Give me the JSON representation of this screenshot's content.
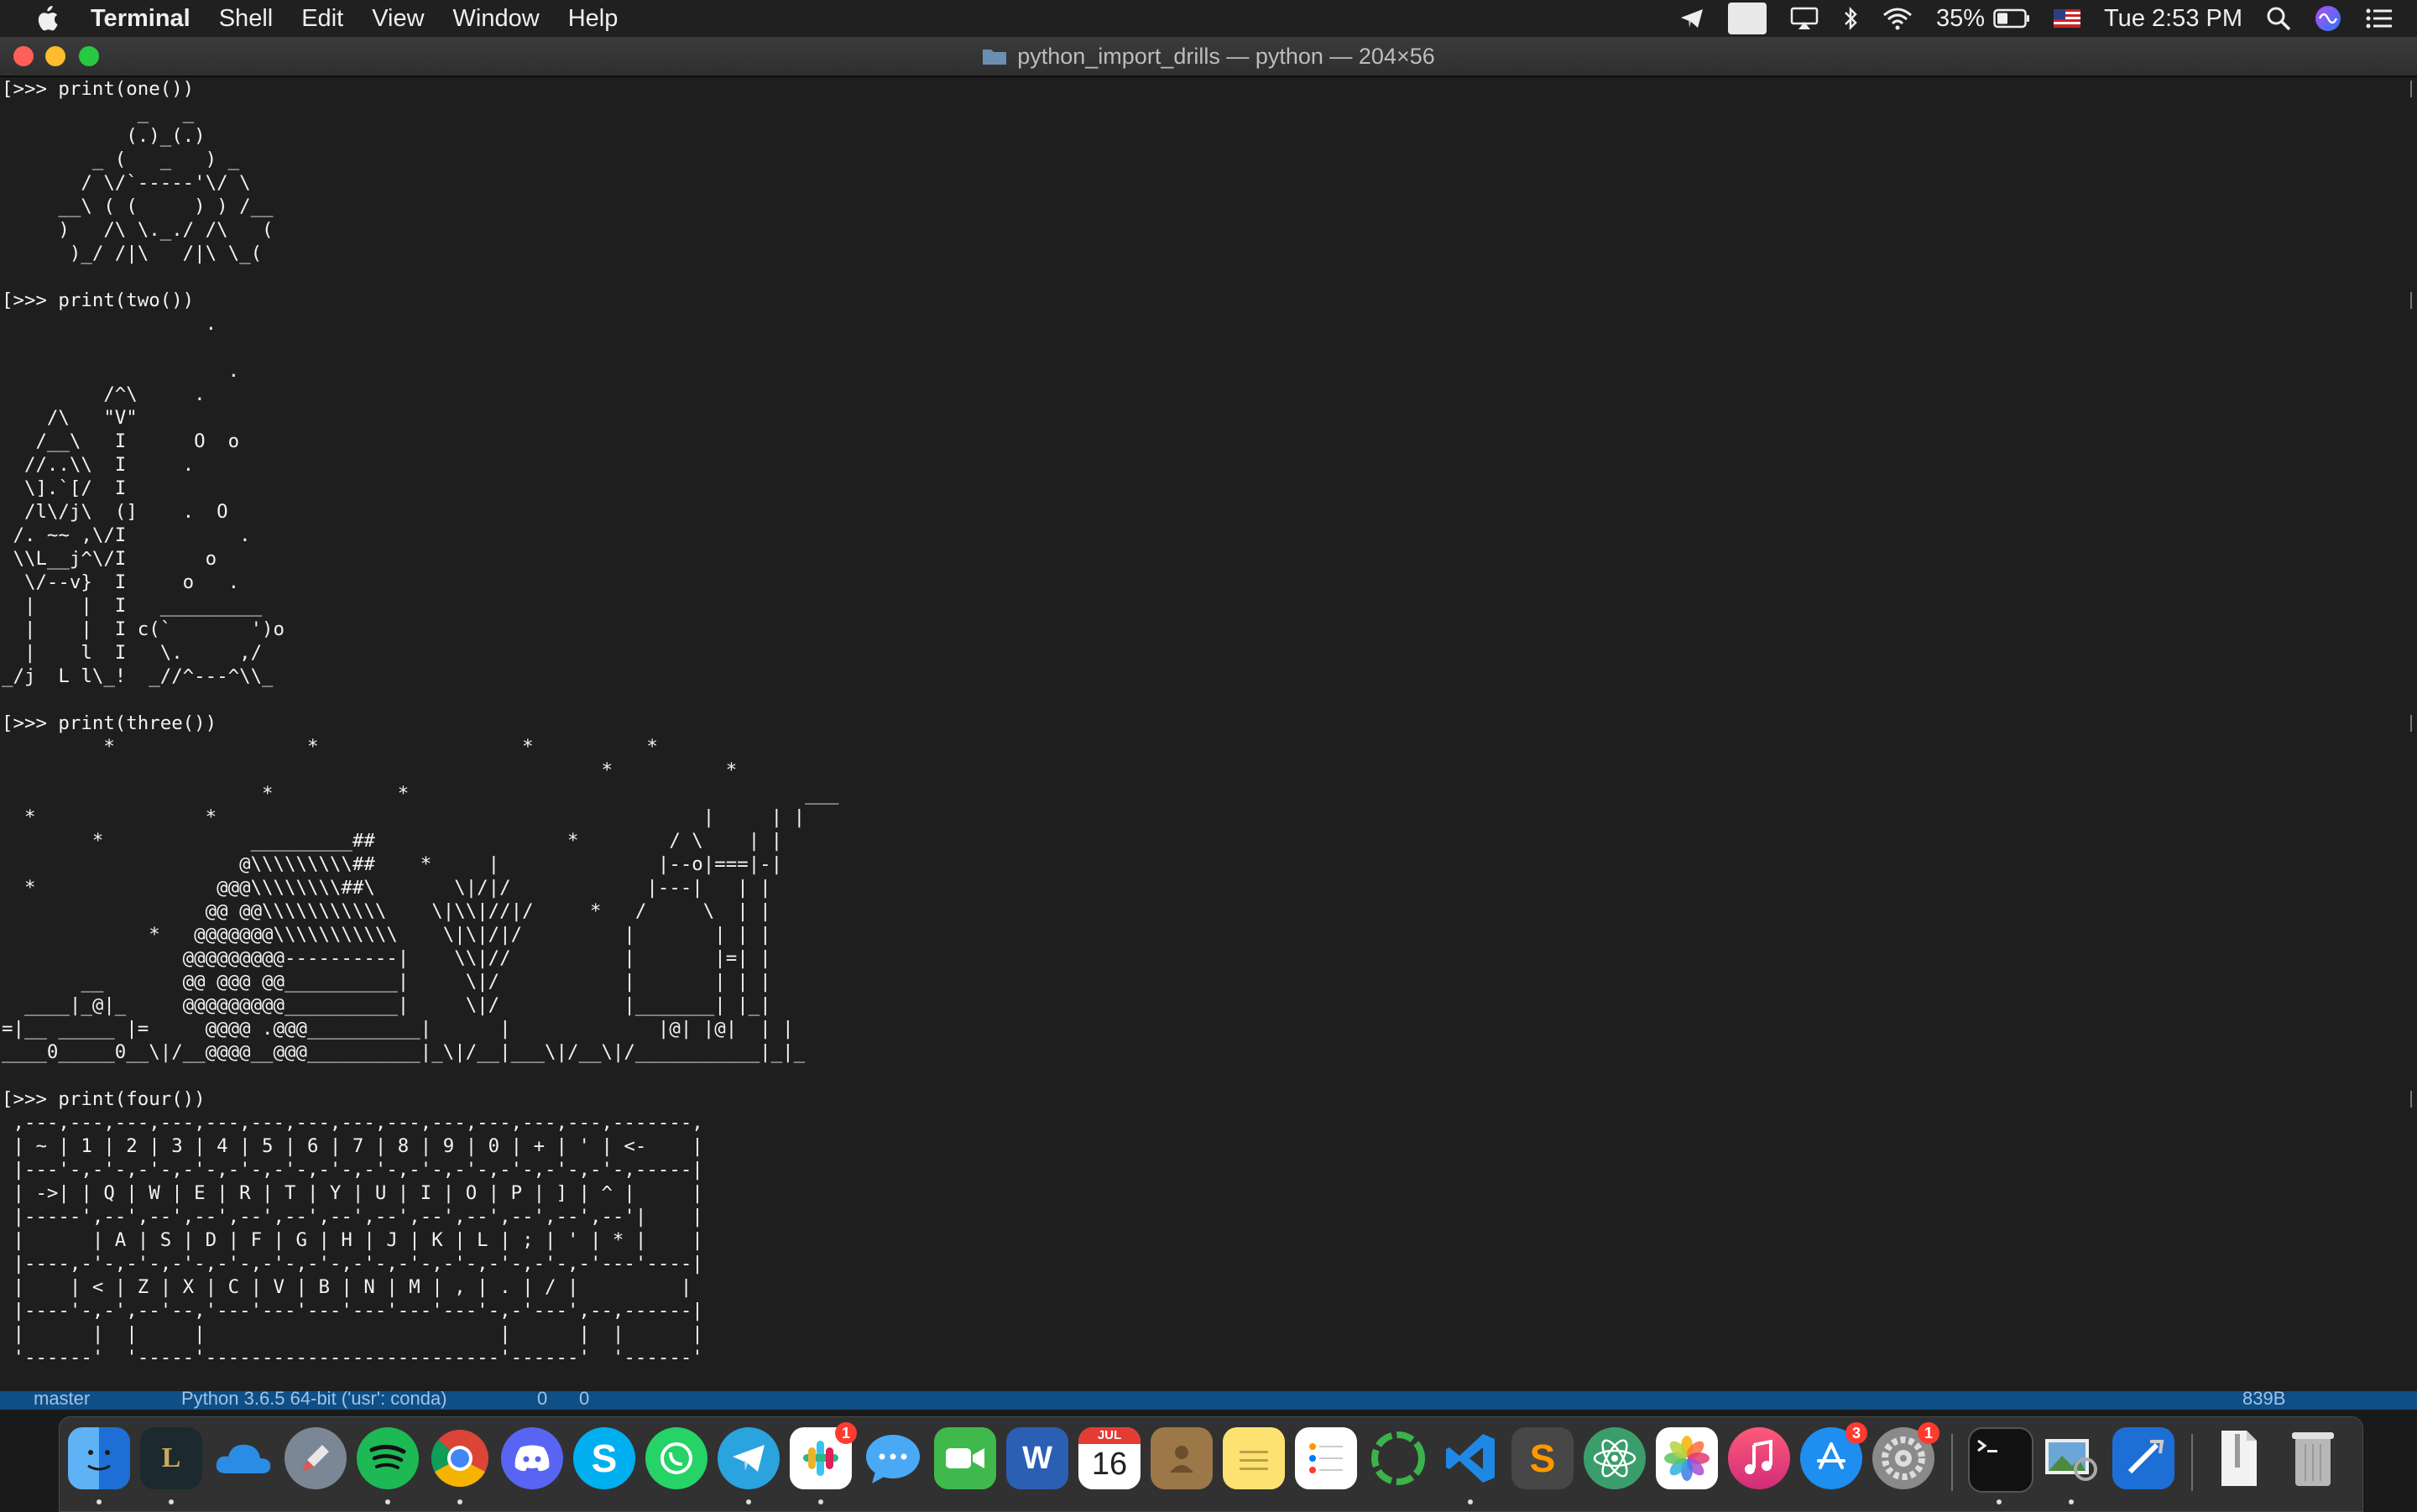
{
  "menubar": {
    "app_name": "Terminal",
    "menus": [
      "Shell",
      "Edit",
      "View",
      "Window",
      "Help"
    ],
    "battery_percent": "35%",
    "clock": "Tue 2:53 PM"
  },
  "window": {
    "title": "python_import_drills — python — 204×56"
  },
  "terminal": {
    "content": "[>>> print(one())\n            _   _\n           (.)_(.)\n        _ (   _   ) _\n       / \\/`-----'\\/ \\\n     __\\ ( (     ) ) /__\n     )   /\\ \\._./ /\\   (\n      )_/ /|\\   /|\\ \\_(\n\n[>>> print(two())\n                  .\n\n                    .\n         /^\\     .\n    /\\   \"V\"\n   /__\\   I      O  o\n  //..\\\\  I     .\n  \\].`[/  I\n  /l\\/j\\  (]    .  O\n /. ~~ ,\\/I          .\n \\\\L__j^\\/I       o\n  \\/--v}  I     o   .\n  |    |  I   _________\n  |    |  I c(`       ')o\n  |    l  I   \\.     ,/\n_/j  L l\\_!  _//^---^\\\\_\n\n[>>> print(three())\n         *                 *                  *          *\n                                                     *          *\n                       *           *                                   ___\n  *               *                                           |     | |\n        *             _________##                 *        / \\    | |\n                     @\\\\\\\\\\\\\\\\\\##    *     |              |--o|===|-|\n  *                @@@\\\\\\\\\\\\\\\\##\\       \\|/|/            |---|   | |\n                  @@ @@\\\\\\\\\\\\\\\\\\\\\\    \\|\\\\|//|/     *   /     \\  | |\n             *   @@@@@@@\\\\\\\\\\\\\\\\\\\\\\    \\|\\|/|/         |       | | |\n                @@@@@@@@@----------|    \\\\|//          |       |=| |\n       __       @@ @@@ @@__________|     \\|/           |       | | |\n  ____|_@|_     @@@@@@@@@__________|     \\|/           |_______| |_|\n=|__ _____ |=     @@@@ .@@@__________|      |             |@| |@|  | |\n____0_____0__\\|/__@@@@__@@@__________|_\\|/__|___\\|/__\\|/___________|_|_\n\n[>>> print(four())\n ,---,---,---,---,---,---,---,---,---,---,---,---,---,-------,\n | ~ | 1 | 2 | 3 | 4 | 5 | 6 | 7 | 8 | 9 | 0 | + | ' | <-    |\n |---'-,-'-,-'-,-'-,-'-,-'-,-'-,-'-,-'-,-'-,-'-,-'-,-'-,-----|\n | ->| | Q | W | E | R | T | Y | U | I | O | P | ] | ^ |     |\n |-----',--',--',--',--',--',--',--',--',--',--',--',--'|    |\n |      | A | S | D | F | G | H | J | K | L | ; | ' | * |    |\n |----,-'-,-'-,-'-,-'-,-'-,-'-,-'-,-'-,-'-,-'-,-'-,-'---'----|\n |    | < | Z | X | C | V | B | N | M | , | . | / |         |\n |----'-,-',--'--,'---'---'---'---'---'---'-,-'---',--,------|\n |      |  |     |                          |      |  |      |\n '------'  '-----'--------------------------'------'  '------'"
  },
  "statusbar": {
    "branch": "master",
    "interpreter": "Python 3.6.5 64-bit ('usr': conda)",
    "problems": "0",
    "warnings": "0",
    "size": "839B"
  },
  "dock": {
    "badges": {
      "slack": "1",
      "app_store": "3",
      "system_preferences": "1"
    },
    "calendar": {
      "month": "JUL",
      "day": "16"
    }
  },
  "colors": {
    "menubar_bg": "#202020",
    "terminal_bg": "#1e1e1e",
    "terminal_text": "#f2f2f2",
    "status_bar": "#0f4f86"
  }
}
